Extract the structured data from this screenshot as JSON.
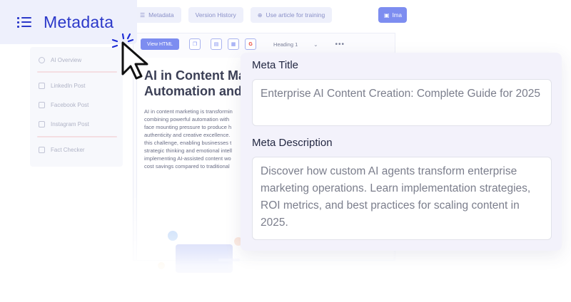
{
  "header": {
    "metadata_label": "Metadata",
    "tabs": [
      {
        "label": "Metadata",
        "icon": "list-icon"
      },
      {
        "label": "Version History",
        "icon": ""
      },
      {
        "label": "Use article for training",
        "icon": "training-icon"
      }
    ],
    "right_button_label": "Ima"
  },
  "sidebar": {
    "items": [
      {
        "label": "AI Overview",
        "icon": "ai-icon"
      },
      {
        "label": "LinkedIn Post",
        "icon": "linkedin-icon"
      },
      {
        "label": "Facebook Post",
        "icon": "facebook-icon"
      },
      {
        "label": "Instagram Post",
        "icon": "instagram-icon"
      },
      {
        "label": "Fact Checker",
        "icon": "fact-check-icon"
      }
    ]
  },
  "editor": {
    "view_html_label": "View HTML",
    "heading_select": "Heading 1",
    "more": "•••",
    "title_line1": "AI in Content Ma",
    "title_line2": "Automation and",
    "body_lines": [
      "AI in content marketing is transformin",
      "combining powerful automation with",
      "face mounting pressure to produce h",
      "authenticity and creative excellence.",
      "this challenge, enabling businesses t",
      "strategic thinking and emotional intell",
      "implementing AI-assisted content wo",
      "cost savings compared to traditional"
    ]
  },
  "meta": {
    "title_label": "Meta Title",
    "title_value": "Enterprise AI Content Creation: Complete Guide for 2025",
    "description_label": "Meta Description",
    "description_value": "Discover how custom AI agents transform enterprise marketing operations. Learn implementation strategies, ROI metrics, and best practices for scaling content in 2025."
  },
  "colors": {
    "accent": "#2b38c9",
    "panel_bg": "#f3f2fb",
    "button_bg": "#7d8df0"
  }
}
